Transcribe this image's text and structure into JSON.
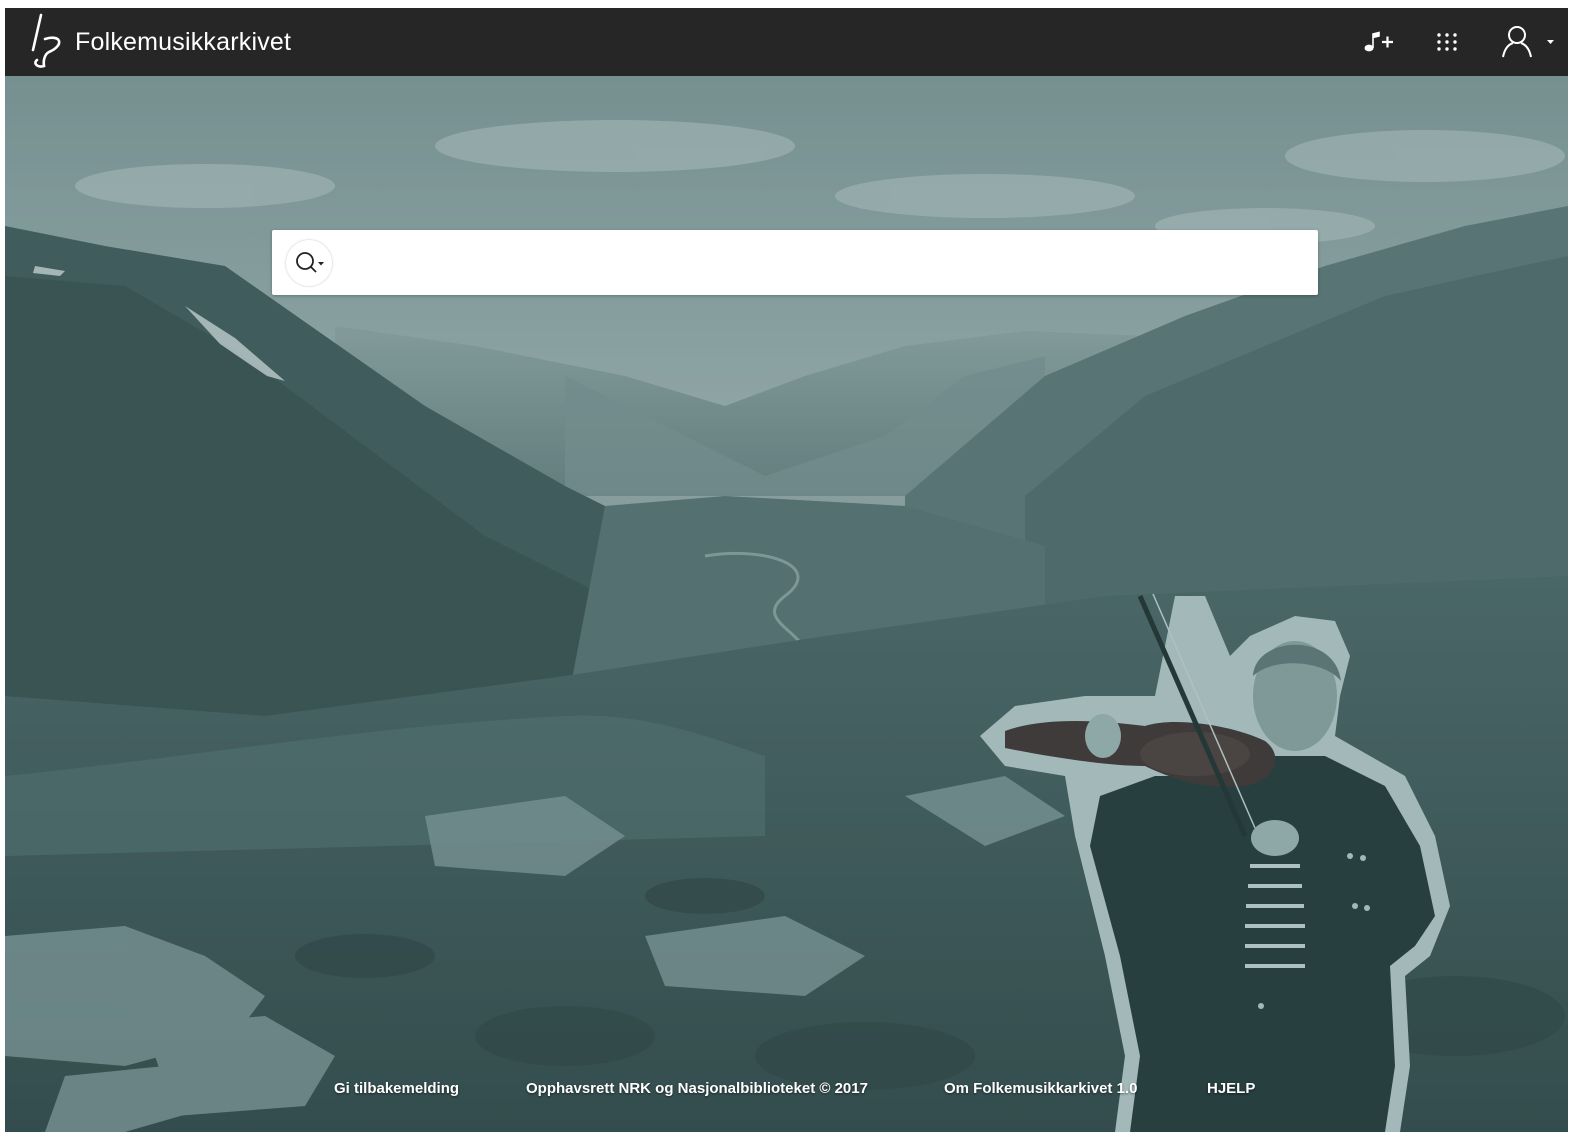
{
  "header": {
    "brand": "Folkemusikkarkivet",
    "icons": {
      "logo": "folkemusikk-logo",
      "add_music": "music-note-plus-icon",
      "apps": "grid-apps-icon",
      "user": "user-account-icon"
    }
  },
  "search": {
    "placeholder": "",
    "value": "",
    "toggle_icon": "search-icon"
  },
  "footer": {
    "feedback": "Gi tilbakemelding",
    "copyright": "Opphavsrett NRK og Nasjonalbiblioteket © 2017",
    "about": "Om Folkemusikkarkivet 1.0",
    "help": "HJELP"
  },
  "colors": {
    "topbar": "#262626",
    "tint": "#5c7a7c",
    "text": "#ffffff"
  }
}
